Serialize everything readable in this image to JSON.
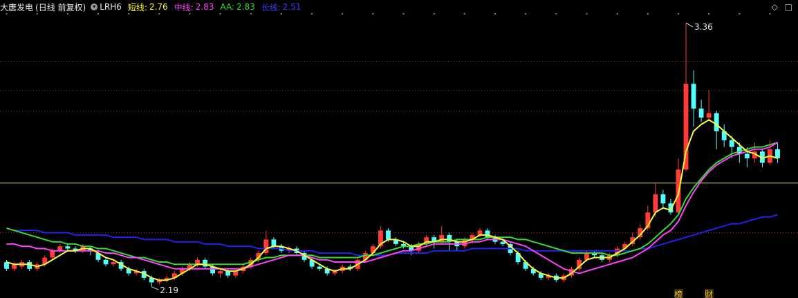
{
  "legend": {
    "stock_name": "大唐发电",
    "period_label": "(日线 前复权)",
    "indicator_name": "LRH6",
    "short_label": "短线:",
    "short_value": "2.76",
    "mid_label": "中线:",
    "mid_value": "2.83",
    "aa_label": "AA:",
    "aa_value": "2.83",
    "long_label": "长线:",
    "long_value": "2.51"
  },
  "corner": {
    "diamond": "◇",
    "close": "□"
  },
  "annotations": {
    "high_label": "3.36",
    "low_label": "2.19",
    "event_1": "榜",
    "event_2": "财"
  },
  "colors": {
    "background": "#000000",
    "up": "#ff3b3b",
    "down": "#54ffff",
    "short_line": "#ffff33",
    "mid_line": "#ff44ff",
    "aa_line": "#33dd33",
    "long_line": "#2222ee",
    "grid": "#b0303a",
    "ref_line": "#e6d36a",
    "dots": "#cc44cc"
  },
  "chart_data": {
    "type": "candlestick",
    "ylim": [
      2.15,
      3.4
    ],
    "reference_line": 2.65,
    "grid_levels": [
      3.19,
      3.06,
      2.97,
      2.43
    ],
    "high_point": 3.36,
    "low_point": 2.19,
    "candles": [
      [
        2.3,
        2.27,
        2.31,
        2.26
      ],
      [
        2.27,
        2.29,
        2.3,
        2.26
      ],
      [
        2.28,
        2.3,
        2.31,
        2.27
      ],
      [
        2.3,
        2.27,
        2.31,
        2.26
      ],
      [
        2.27,
        2.29,
        2.3,
        2.26
      ],
      [
        2.29,
        2.32,
        2.33,
        2.28
      ],
      [
        2.32,
        2.35,
        2.36,
        2.31
      ],
      [
        2.35,
        2.37,
        2.38,
        2.34
      ],
      [
        2.37,
        2.36,
        2.38,
        2.35
      ],
      [
        2.36,
        2.35,
        2.37,
        2.34
      ],
      [
        2.35,
        2.37,
        2.38,
        2.34
      ],
      [
        2.36,
        2.35,
        2.37,
        2.33
      ],
      [
        2.34,
        2.31,
        2.35,
        2.3
      ],
      [
        2.31,
        2.29,
        2.32,
        2.28
      ],
      [
        2.29,
        2.3,
        2.31,
        2.28
      ],
      [
        2.3,
        2.27,
        2.31,
        2.26
      ],
      [
        2.27,
        2.25,
        2.28,
        2.24
      ],
      [
        2.25,
        2.26,
        2.27,
        2.24
      ],
      [
        2.26,
        2.23,
        2.27,
        2.22
      ],
      [
        2.23,
        2.21,
        2.24,
        2.19
      ],
      [
        2.21,
        2.22,
        2.23,
        2.2
      ],
      [
        2.22,
        2.23,
        2.24,
        2.21
      ],
      [
        2.23,
        2.25,
        2.26,
        2.22
      ],
      [
        2.25,
        2.27,
        2.28,
        2.24
      ],
      [
        2.27,
        2.29,
        2.3,
        2.26
      ],
      [
        2.29,
        2.31,
        2.32,
        2.28
      ],
      [
        2.31,
        2.28,
        2.32,
        2.27
      ],
      [
        2.28,
        2.25,
        2.29,
        2.24
      ],
      [
        2.25,
        2.26,
        2.27,
        2.23
      ],
      [
        2.26,
        2.24,
        2.27,
        2.23
      ],
      [
        2.24,
        2.26,
        2.27,
        2.23
      ],
      [
        2.26,
        2.28,
        2.29,
        2.25
      ],
      [
        2.28,
        2.31,
        2.32,
        2.27
      ],
      [
        2.31,
        2.34,
        2.35,
        2.3
      ],
      [
        2.34,
        2.4,
        2.44,
        2.33
      ],
      [
        2.4,
        2.37,
        2.41,
        2.36
      ],
      [
        2.37,
        2.35,
        2.38,
        2.34
      ],
      [
        2.35,
        2.36,
        2.37,
        2.34
      ],
      [
        2.36,
        2.34,
        2.37,
        2.33
      ],
      [
        2.34,
        2.31,
        2.35,
        2.3
      ],
      [
        2.31,
        2.28,
        2.32,
        2.27
      ],
      [
        2.28,
        2.27,
        2.29,
        2.26
      ],
      [
        2.27,
        2.25,
        2.28,
        2.24
      ],
      [
        2.25,
        2.26,
        2.27,
        2.24
      ],
      [
        2.26,
        2.28,
        2.29,
        2.25
      ],
      [
        2.28,
        2.27,
        2.29,
        2.26
      ],
      [
        2.27,
        2.31,
        2.32,
        2.26
      ],
      [
        2.31,
        2.34,
        2.35,
        2.3
      ],
      [
        2.34,
        2.37,
        2.38,
        2.33
      ],
      [
        2.37,
        2.44,
        2.46,
        2.36
      ],
      [
        2.44,
        2.4,
        2.45,
        2.39
      ],
      [
        2.4,
        2.38,
        2.41,
        2.37
      ],
      [
        2.38,
        2.37,
        2.39,
        2.36
      ],
      [
        2.37,
        2.35,
        2.38,
        2.33
      ],
      [
        2.35,
        2.38,
        2.39,
        2.34
      ],
      [
        2.38,
        2.41,
        2.42,
        2.37
      ],
      [
        2.41,
        2.39,
        2.42,
        2.36
      ],
      [
        2.39,
        2.42,
        2.46,
        2.38
      ],
      [
        2.42,
        2.39,
        2.43,
        2.35
      ],
      [
        2.39,
        2.37,
        2.4,
        2.35
      ],
      [
        2.37,
        2.4,
        2.41,
        2.36
      ],
      [
        2.4,
        2.42,
        2.43,
        2.38
      ],
      [
        2.42,
        2.44,
        2.45,
        2.41
      ],
      [
        2.44,
        2.41,
        2.45,
        2.4
      ],
      [
        2.41,
        2.39,
        2.42,
        2.38
      ],
      [
        2.39,
        2.38,
        2.4,
        2.37
      ],
      [
        2.38,
        2.34,
        2.39,
        2.33
      ],
      [
        2.34,
        2.3,
        2.35,
        2.29
      ],
      [
        2.3,
        2.27,
        2.31,
        2.26
      ],
      [
        2.27,
        2.25,
        2.28,
        2.24
      ],
      [
        2.25,
        2.23,
        2.26,
        2.22
      ],
      [
        2.23,
        2.24,
        2.25,
        2.22
      ],
      [
        2.24,
        2.22,
        2.25,
        2.21
      ],
      [
        2.22,
        2.24,
        2.25,
        2.21
      ],
      [
        2.24,
        2.27,
        2.28,
        2.23
      ],
      [
        2.27,
        2.31,
        2.32,
        2.26
      ],
      [
        2.31,
        2.34,
        2.35,
        2.3
      ],
      [
        2.34,
        2.33,
        2.35,
        2.32
      ],
      [
        2.33,
        2.31,
        2.34,
        2.3
      ],
      [
        2.31,
        2.33,
        2.34,
        2.3
      ],
      [
        2.33,
        2.36,
        2.37,
        2.32
      ],
      [
        2.36,
        2.38,
        2.39,
        2.35
      ],
      [
        2.38,
        2.41,
        2.43,
        2.37
      ],
      [
        2.41,
        2.45,
        2.47,
        2.4
      ],
      [
        2.45,
        2.52,
        2.55,
        2.44
      ],
      [
        2.52,
        2.6,
        2.65,
        2.5
      ],
      [
        2.6,
        2.56,
        2.62,
        2.54
      ],
      [
        2.56,
        2.52,
        2.58,
        2.51
      ],
      [
        2.52,
        2.71,
        2.76,
        2.51
      ],
      [
        2.71,
        3.09,
        3.36,
        2.7
      ],
      [
        3.09,
        2.98,
        3.15,
        2.9
      ],
      [
        2.98,
        2.94,
        3.02,
        2.92
      ],
      [
        2.94,
        2.96,
        3.06,
        2.93
      ],
      [
        2.96,
        2.88,
        2.97,
        2.8
      ],
      [
        2.88,
        2.84,
        2.91,
        2.81
      ],
      [
        2.84,
        2.81,
        2.86,
        2.76
      ],
      [
        2.81,
        2.78,
        2.83,
        2.74
      ],
      [
        2.78,
        2.76,
        2.81,
        2.72
      ],
      [
        2.76,
        2.79,
        2.83,
        2.74
      ],
      [
        2.79,
        2.74,
        2.8,
        2.72
      ],
      [
        2.74,
        2.8,
        2.84,
        2.73
      ],
      [
        2.8,
        2.76,
        2.83,
        2.74
      ]
    ],
    "series": [
      {
        "name": "短线",
        "values": [
          2.3,
          2.29,
          2.29,
          2.29,
          2.28,
          2.29,
          2.31,
          2.33,
          2.35,
          2.35,
          2.36,
          2.36,
          2.34,
          2.32,
          2.31,
          2.29,
          2.27,
          2.26,
          2.25,
          2.23,
          2.22,
          2.22,
          2.23,
          2.25,
          2.27,
          2.29,
          2.29,
          2.28,
          2.27,
          2.26,
          2.26,
          2.27,
          2.29,
          2.32,
          2.36,
          2.37,
          2.37,
          2.36,
          2.35,
          2.33,
          2.31,
          2.29,
          2.27,
          2.26,
          2.27,
          2.27,
          2.29,
          2.31,
          2.34,
          2.38,
          2.4,
          2.4,
          2.39,
          2.37,
          2.37,
          2.39,
          2.39,
          2.4,
          2.4,
          2.39,
          2.39,
          2.4,
          2.42,
          2.42,
          2.41,
          2.4,
          2.37,
          2.34,
          2.3,
          2.27,
          2.25,
          2.24,
          2.23,
          2.23,
          2.25,
          2.28,
          2.31,
          2.32,
          2.32,
          2.32,
          2.34,
          2.36,
          2.39,
          2.42,
          2.46,
          2.52,
          2.54,
          2.53,
          2.6,
          2.79,
          2.88,
          2.91,
          2.93,
          2.91,
          2.88,
          2.85,
          2.82,
          2.79,
          2.78,
          2.76,
          2.77,
          2.76
        ]
      },
      {
        "name": "中线",
        "values": [
          2.38,
          2.38,
          2.37,
          2.37,
          2.36,
          2.36,
          2.35,
          2.35,
          2.35,
          2.35,
          2.35,
          2.35,
          2.35,
          2.34,
          2.34,
          2.33,
          2.32,
          2.32,
          2.31,
          2.3,
          2.29,
          2.28,
          2.27,
          2.27,
          2.27,
          2.27,
          2.27,
          2.27,
          2.27,
          2.27,
          2.27,
          2.27,
          2.28,
          2.29,
          2.3,
          2.31,
          2.32,
          2.33,
          2.33,
          2.33,
          2.32,
          2.31,
          2.31,
          2.3,
          2.3,
          2.3,
          2.3,
          2.3,
          2.31,
          2.32,
          2.33,
          2.34,
          2.35,
          2.35,
          2.36,
          2.37,
          2.38,
          2.38,
          2.38,
          2.38,
          2.38,
          2.39,
          2.39,
          2.4,
          2.4,
          2.4,
          2.39,
          2.38,
          2.37,
          2.35,
          2.33,
          2.31,
          2.29,
          2.27,
          2.26,
          2.25,
          2.26,
          2.27,
          2.28,
          2.29,
          2.3,
          2.31,
          2.32,
          2.34,
          2.36,
          2.39,
          2.42,
          2.44,
          2.48,
          2.55,
          2.61,
          2.66,
          2.7,
          2.73,
          2.75,
          2.77,
          2.78,
          2.79,
          2.8,
          2.8,
          2.81,
          2.83
        ]
      },
      {
        "name": "AA",
        "values": [
          2.45,
          2.44,
          2.43,
          2.42,
          2.41,
          2.4,
          2.39,
          2.39,
          2.38,
          2.38,
          2.37,
          2.37,
          2.36,
          2.36,
          2.35,
          2.34,
          2.33,
          2.32,
          2.32,
          2.31,
          2.3,
          2.3,
          2.29,
          2.29,
          2.29,
          2.29,
          2.29,
          2.29,
          2.29,
          2.29,
          2.29,
          2.29,
          2.3,
          2.31,
          2.32,
          2.32,
          2.33,
          2.33,
          2.33,
          2.33,
          2.33,
          2.32,
          2.32,
          2.32,
          2.32,
          2.32,
          2.32,
          2.33,
          2.33,
          2.34,
          2.35,
          2.36,
          2.37,
          2.37,
          2.38,
          2.38,
          2.39,
          2.39,
          2.39,
          2.4,
          2.4,
          2.4,
          2.4,
          2.41,
          2.41,
          2.41,
          2.41,
          2.4,
          2.4,
          2.39,
          2.38,
          2.37,
          2.36,
          2.35,
          2.34,
          2.34,
          2.34,
          2.34,
          2.34,
          2.33,
          2.33,
          2.34,
          2.35,
          2.36,
          2.38,
          2.41,
          2.44,
          2.47,
          2.51,
          2.58,
          2.63,
          2.67,
          2.71,
          2.74,
          2.76,
          2.78,
          2.79,
          2.8,
          2.81,
          2.81,
          2.82,
          2.83
        ]
      },
      {
        "name": "长线",
        "values": [
          2.45,
          2.44,
          2.44,
          2.44,
          2.44,
          2.43,
          2.43,
          2.43,
          2.43,
          2.42,
          2.42,
          2.42,
          2.42,
          2.42,
          2.41,
          2.41,
          2.41,
          2.41,
          2.4,
          2.4,
          2.4,
          2.4,
          2.39,
          2.39,
          2.39,
          2.39,
          2.38,
          2.38,
          2.38,
          2.37,
          2.37,
          2.37,
          2.37,
          2.36,
          2.36,
          2.36,
          2.36,
          2.35,
          2.35,
          2.35,
          2.35,
          2.34,
          2.34,
          2.34,
          2.34,
          2.34,
          2.33,
          2.33,
          2.33,
          2.33,
          2.33,
          2.34,
          2.34,
          2.34,
          2.34,
          2.34,
          2.35,
          2.35,
          2.35,
          2.35,
          2.35,
          2.36,
          2.36,
          2.36,
          2.36,
          2.36,
          2.36,
          2.36,
          2.35,
          2.35,
          2.35,
          2.35,
          2.35,
          2.35,
          2.35,
          2.35,
          2.35,
          2.35,
          2.35,
          2.35,
          2.35,
          2.35,
          2.35,
          2.36,
          2.36,
          2.37,
          2.38,
          2.39,
          2.4,
          2.41,
          2.42,
          2.43,
          2.44,
          2.45,
          2.46,
          2.47,
          2.47,
          2.48,
          2.49,
          2.5,
          2.5,
          2.51
        ]
      }
    ]
  }
}
